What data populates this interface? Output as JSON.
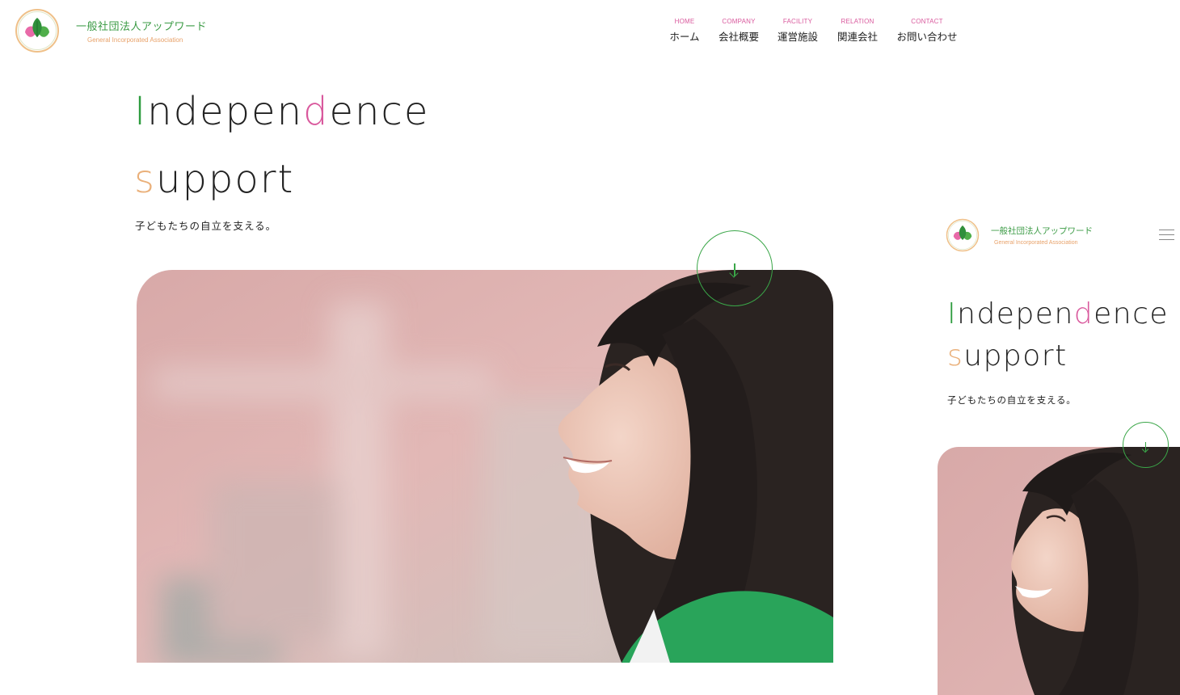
{
  "brand": {
    "name_jp": "一般社団法人アップワード",
    "name_en": "General Incorporated Association"
  },
  "nav": [
    {
      "en": "HOME",
      "jp": "ホーム"
    },
    {
      "en": "COMPANY",
      "jp": "会社概要"
    },
    {
      "en": "FACILITY",
      "jp": "運営施設"
    },
    {
      "en": "RELATION",
      "jp": "関連会社"
    },
    {
      "en": "CONTACT",
      "jp": "お問い合わせ"
    }
  ],
  "hero": {
    "line1": {
      "first": "I",
      "mid1": "ndepen",
      "accent": "d",
      "mid2": "ence"
    },
    "line2": {
      "first": "s",
      "rest": "upport"
    },
    "tagline": "子どもたちの自立を支える。"
  },
  "colors": {
    "green": "#2e9c3f",
    "pink": "#d9599d",
    "orange": "#eab07a",
    "circle": "#3aa648"
  },
  "icons": {
    "logo": "leaf-logo-icon",
    "scroll": "arrow-down-icon",
    "menu": "hamburger-menu-icon"
  }
}
